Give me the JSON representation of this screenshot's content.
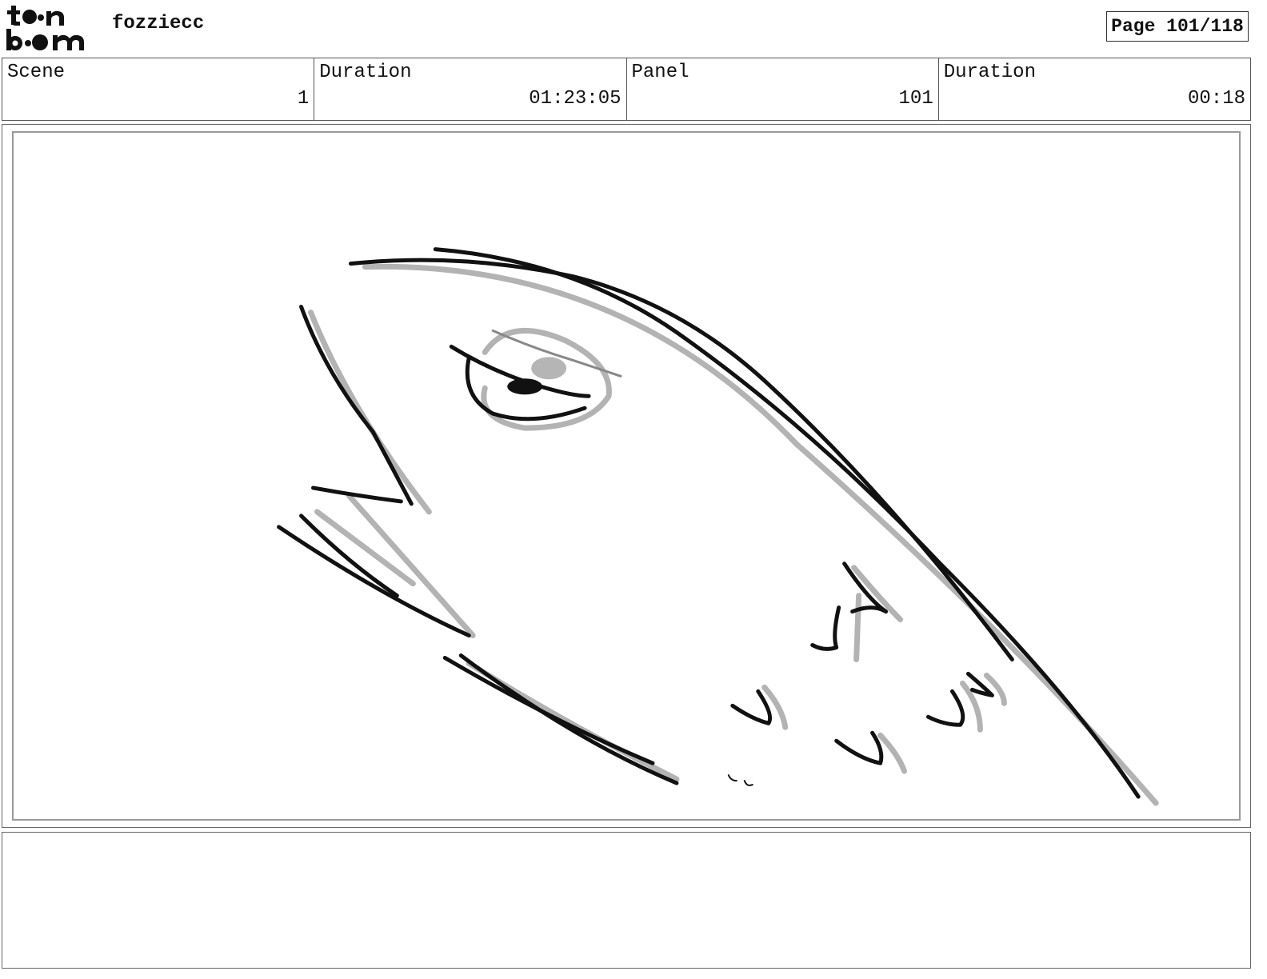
{
  "header": {
    "logo_name": "toon boom",
    "project_title": "fozziecc",
    "page_label": "Page 101/118"
  },
  "info_bar": {
    "scene_label": "Scene",
    "scene_value": "1",
    "scene_duration_label": "Duration",
    "scene_duration_value": "01:23:05",
    "panel_label": "Panel",
    "panel_value": "101",
    "panel_duration_label": "Duration",
    "panel_duration_value": "00:18"
  },
  "panel": {
    "content": "sketch",
    "ink_color": "#111111",
    "shadow_color": "#b0b0b0"
  },
  "notes": {
    "text": ""
  }
}
